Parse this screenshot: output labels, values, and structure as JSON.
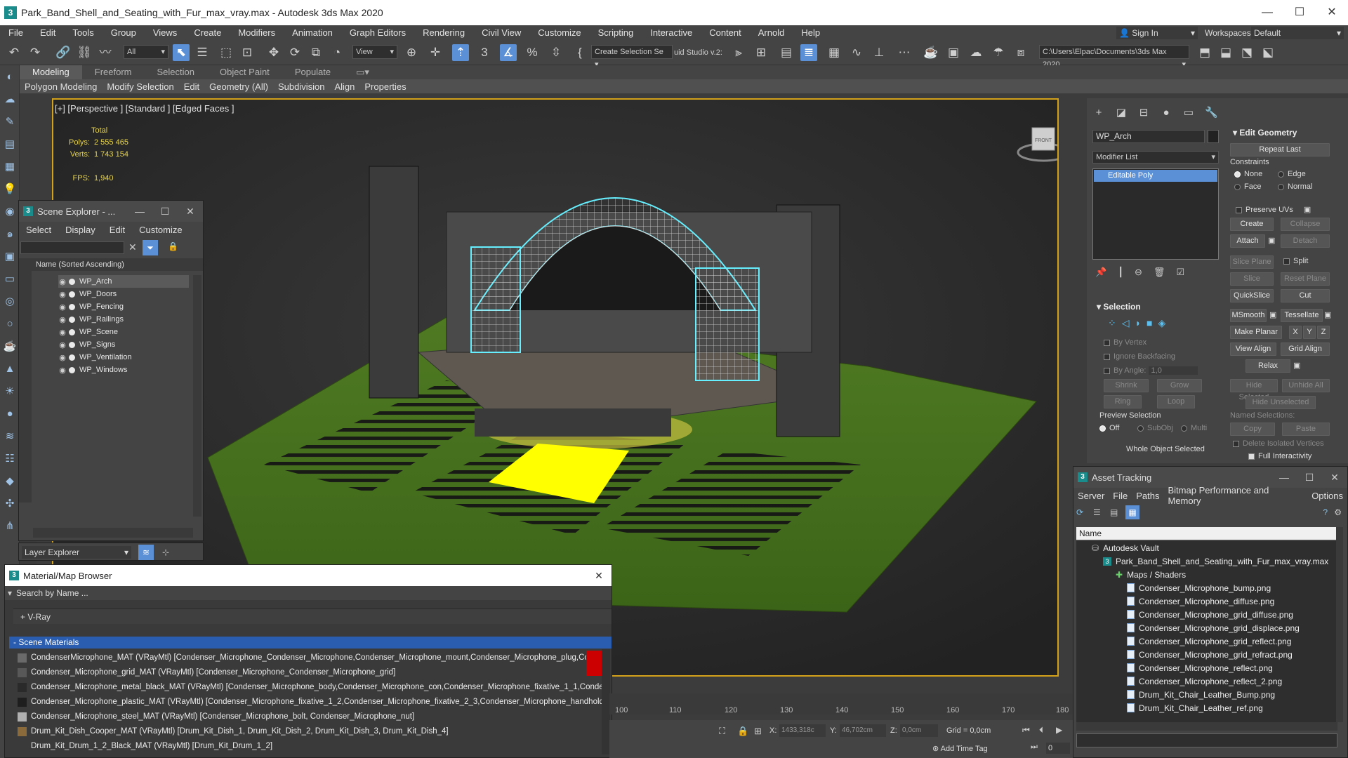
{
  "app": {
    "title": "Park_Band_Shell_and_Seating_with_Fur_max_vray.max - Autodesk 3ds Max 2020",
    "window_controls": [
      "—",
      "☐",
      "✕"
    ]
  },
  "menu": [
    "File",
    "Edit",
    "Tools",
    "Group",
    "Views",
    "Create",
    "Modifiers",
    "Animation",
    "Graph Editors",
    "Rendering",
    "Civil View",
    "Customize",
    "Scripting",
    "Interactive",
    "Content",
    "Arnold",
    "Help"
  ],
  "toolbar": {
    "filter_combo": "All",
    "view_combo": "View",
    "selection_set": "Create Selection Se",
    "studio_label": "uid Studio v.2:",
    "sign_in": "Sign In",
    "workspaces_label": "Workspaces:",
    "workspace_value": "Default",
    "path": "C:\\Users\\Elpac\\Documents\\3ds Max 2020"
  },
  "ribbon": {
    "tabs": [
      "Modeling",
      "Freeform",
      "Selection",
      "Object Paint",
      "Populate"
    ],
    "subtabs": [
      "Polygon Modeling",
      "Modify Selection",
      "Edit",
      "Geometry (All)",
      "Subdivision",
      "Align",
      "Properties"
    ]
  },
  "viewport": {
    "label": "[+] [Perspective ] [Standard ] [Edged Faces ]",
    "stats_header": "Total",
    "polys_label": "Polys:",
    "polys_value": "2 555 465",
    "verts_label": "Verts:",
    "verts_value": "1 743 154",
    "fps_label": "FPS:",
    "fps_value": "1,940",
    "viewcube": "FRONT"
  },
  "scene_explorer": {
    "title": "Scene Explorer - ...",
    "menu": [
      "Select",
      "Display",
      "Edit",
      "Customize"
    ],
    "column": "Name (Sorted Ascending)",
    "items": [
      "WP_Arch",
      "WP_Doors",
      "WP_Fencing",
      "WP_Railings",
      "WP_Scene",
      "WP_Signs",
      "WP_Ventilation",
      "WP_Windows"
    ],
    "footer": "Layer Explorer"
  },
  "command_panel": {
    "object_name": "WP_Arch",
    "modifier_list": "Modifier List",
    "stack_item": "Editable Poly",
    "edit_geometry": {
      "title": "Edit Geometry",
      "repeat_last": "Repeat Last",
      "constraints": "Constraints",
      "none": "None",
      "edge": "Edge",
      "face": "Face",
      "normal": "Normal",
      "preserve_uvs": "Preserve UVs",
      "create": "Create",
      "collapse": "Collapse",
      "attach": "Attach",
      "detach": "Detach",
      "slice_plane": "Slice Plane",
      "split": "Split",
      "slice": "Slice",
      "reset_plane": "Reset Plane",
      "quickslice": "QuickSlice",
      "cut": "Cut",
      "msmooth": "MSmooth",
      "tessellate": "Tessellate",
      "make_planar": "Make Planar",
      "x": "X",
      "y": "Y",
      "z": "Z",
      "view_align": "View Align",
      "grid_align": "Grid Align",
      "relax": "Relax",
      "hide_selected": "Hide Selected",
      "unhide_all": "Unhide All",
      "hide_unselected": "Hide Unselected",
      "named_selections": "Named Selections:",
      "copy": "Copy",
      "paste": "Paste",
      "delete_isolated": "Delete Isolated Vertices",
      "full_interactivity": "Full Interactivity"
    },
    "selection": {
      "title": "Selection",
      "by_vertex": "By Vertex",
      "ignore_backfacing": "Ignore Backfacing",
      "by_angle": "By Angle:",
      "by_angle_value": "1,0",
      "shrink": "Shrink",
      "grow": "Grow",
      "ring": "Ring",
      "loop": "Loop",
      "preview_selection": "Preview Selection",
      "off": "Off",
      "subobj": "SubObj",
      "multi": "Multi",
      "status": "Whole Object Selected"
    }
  },
  "material_browser": {
    "title": "Material/Map Browser",
    "search_placeholder": "Search by Name ...",
    "vray_group": "+ V-Ray",
    "scene_materials": "- Scene Materials",
    "materials": [
      {
        "text": "CondenserMicrophone_MAT (VRayMtl) [Condenser_Microphone_Condenser_Microphone,Condenser_Microphone_mount,Condenser_Microphone_plug,Conde...",
        "swatch": "#6a6a6a"
      },
      {
        "text": "Condenser_Microphone_grid_MAT (VRayMtl) [Condenser_Microphone_Condenser_Microphone_grid]",
        "swatch": "#585858"
      },
      {
        "text": "Condenser_Microphone_metal_black_MAT (VRayMtl) [Condenser_Microphone_body,Condenser_Microphone_con,Condenser_Microphone_fixative_1_1,Conde...",
        "swatch": "#2a2a2a"
      },
      {
        "text": "Condenser_Microphone_plastic_MAT (VRayMtl) [Condenser_Microphone_fixative_1_2,Condenser_Microphone_fixative_2_3,Condenser_Microphone_handhold]",
        "swatch": "#1e1e1e"
      },
      {
        "text": "Condenser_Microphone_steel_MAT (VRayMtl) [Condenser_Microphone_bolt, Condenser_Microphone_nut]",
        "swatch": "#b0b0b0"
      },
      {
        "text": "Drum_Kit_Dish_Cooper_MAT (VRayMtl) [Drum_Kit_Dish_1, Drum_Kit_Dish_2, Drum_Kit_Dish_3, Drum_Kit_Dish_4]",
        "swatch": "#8a6a3a"
      },
      {
        "text": "Drum_Kit_Drum_1_2_Black_MAT (VRayMtl) [Drum_Kit_Drum_1_2]",
        "swatch": "#3a3a3a"
      }
    ]
  },
  "asset_tracking": {
    "title": "Asset Tracking",
    "menu": [
      "Server",
      "File",
      "Paths",
      "Bitmap Performance and Memory",
      "Options"
    ],
    "column": "Name",
    "vault": "Autodesk Vault",
    "file": "Park_Band_Shell_and_Seating_with_Fur_max_vray.max",
    "maps_group": "Maps / Shaders",
    "maps": [
      "Condenser_Microphone_bump.png",
      "Condenser_Microphone_diffuse.png",
      "Condenser_Microphone_grid_diffuse.png",
      "Condenser_Microphone_grid_displace.png",
      "Condenser_Microphone_grid_reflect.png",
      "Condenser_Microphone_grid_refract.png",
      "Condenser_Microphone_reflect.png",
      "Condenser_Microphone_reflect_2.png",
      "Drum_Kit_Chair_Leather_Bump.png",
      "Drum_Kit_Chair_Leather_ref.png"
    ]
  },
  "timeline": {
    "ticks": [
      "100",
      "110",
      "120",
      "130",
      "140",
      "150",
      "160",
      "170",
      "180"
    ]
  },
  "status": {
    "x_label": "X:",
    "x_value": "1433,318c",
    "y_label": "Y:",
    "y_value": "46,702cm",
    "z_label": "Z:",
    "z_value": "0,0cm",
    "grid": "Grid = 0,0cm",
    "add_time_tag": "Add Time Tag",
    "frame": "0"
  }
}
